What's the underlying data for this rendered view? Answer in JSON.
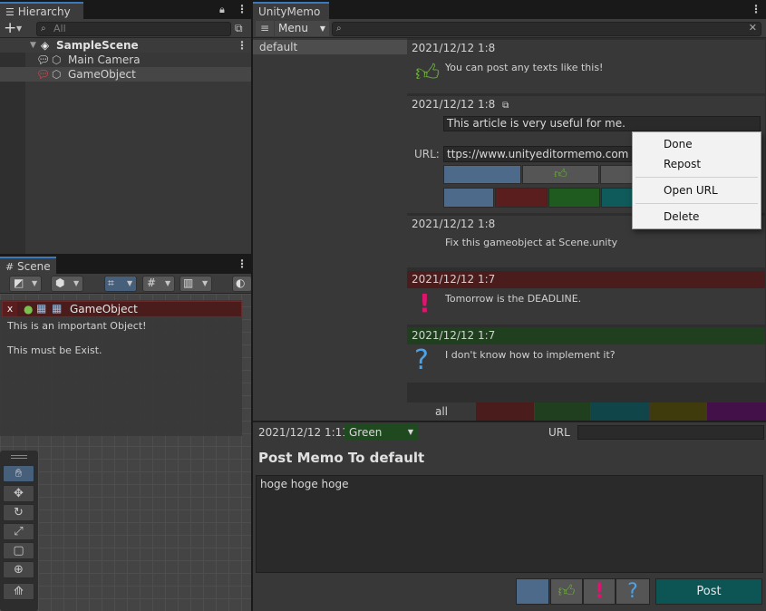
{
  "hierarchy": {
    "tab_label": "Hierarchy",
    "search_placeholder": "All",
    "scene_name": "SampleScene",
    "items": [
      {
        "label": "Main Camera"
      },
      {
        "label": "GameObject"
      }
    ]
  },
  "scene": {
    "tab_label": "Scene",
    "overlay": {
      "close_label": "x",
      "object_name": "GameObject",
      "lines": [
        "This is an important Object!",
        "This must be Exist."
      ]
    }
  },
  "unitymemo": {
    "tab_label": "UnityMemo",
    "menu_label": "Menu",
    "categories": [
      "default"
    ],
    "memos": [
      {
        "date": "2021/12/12 1:8",
        "text": "You can post any texts like this!",
        "icon": "thumbs-up-icon",
        "header_color": "#383838"
      },
      {
        "date": "2021/12/12 1:8",
        "text": "This article is very useful for me.",
        "url_label": "URL:",
        "url_value": "ttps://www.unityeditormemo.com",
        "header_color": "#383838"
      },
      {
        "date": "2021/12/12 1:8",
        "text": "Fix this gameobject at Scene.unity",
        "header_color": "#383838"
      },
      {
        "date": "2021/12/12 1:7",
        "text": "Tomorrow is the DEADLINE.",
        "icon": "exclamation-icon",
        "header_color": "#4a1c1c"
      },
      {
        "date": "2021/12/12 1:7",
        "text": "I don't know how to implement it?",
        "icon": "question-icon",
        "header_color": "#1f3f1f"
      }
    ],
    "filter": {
      "all_label": "all",
      "colors": [
        "#4a1c1c",
        "#1f3f1f",
        "#10454a",
        "#3f3b0d",
        "#44104a"
      ]
    },
    "context_menu": [
      "Done",
      "Repost",
      "Open URL",
      "Delete"
    ],
    "post": {
      "date": "2021/12/12 1:11",
      "color_label": "Green",
      "url_label": "URL",
      "url_value": "",
      "title": "Post Memo To default",
      "body": "hoge hoge hoge",
      "post_button": "Post"
    },
    "colors": {
      "normal": "#4e6a8a",
      "red": "#5a1e1e",
      "green": "#1f5a1f",
      "teal": "#0f5a5a",
      "post_button": "#0d5454",
      "thumb": "#6aaa3a",
      "exclaim": "#e0146e",
      "question": "#4aa3e8"
    }
  }
}
